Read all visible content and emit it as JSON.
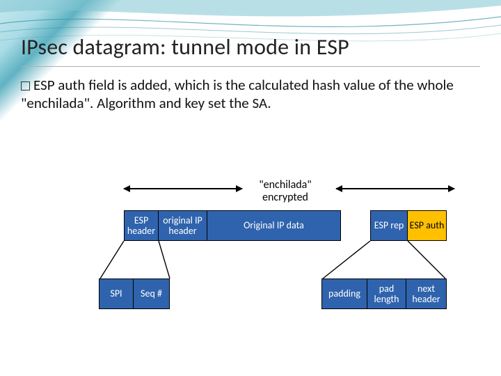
{
  "title": "IPsec datagram: tunnel mode in ESP",
  "bullet_text": "ESP auth field is added, which is the calculated hash value of the whole \"enchilada\". Algorithm and key set the SA.",
  "labels": {
    "enchilada": "\"enchilada\"",
    "encrypted": "encrypted"
  },
  "packet_cells": {
    "esp_header": "ESP header",
    "orig_ip_header": "original IP header",
    "orig_ip_data": "Original IP data",
    "esp_rep": "ESP rep",
    "esp_auth": "ESP auth"
  },
  "esp_header_detail": {
    "spi": "SPI",
    "seq": "Seq #"
  },
  "esp_trailer_detail": {
    "padding": "padding",
    "pad_length": "pad length",
    "next_header": "next header"
  }
}
